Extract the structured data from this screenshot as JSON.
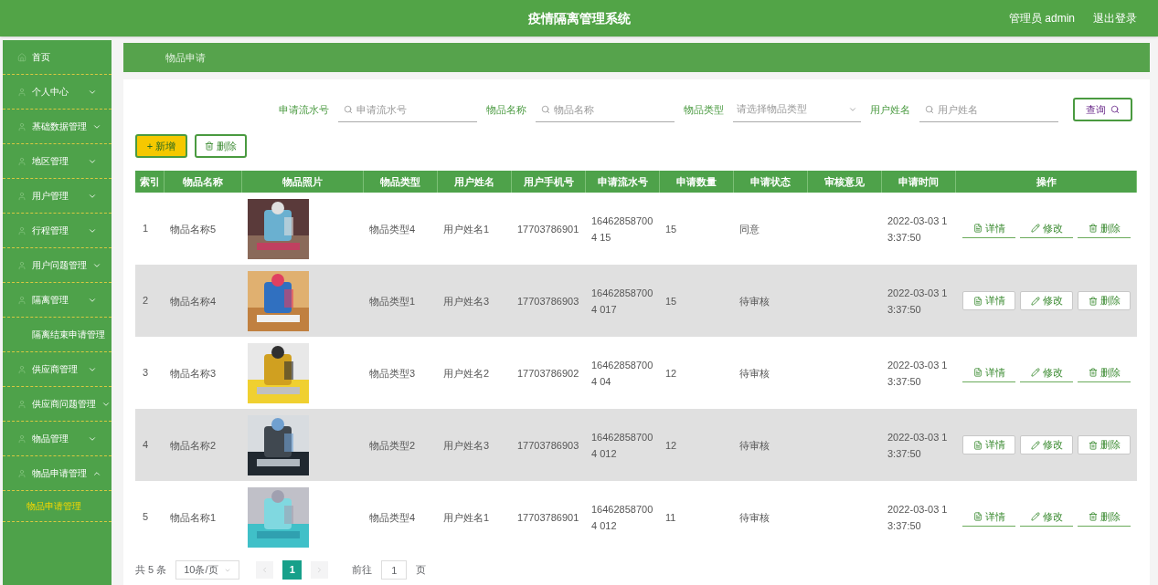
{
  "header": {
    "title": "疫情隔离管理系统",
    "user": "管理员 admin",
    "logout": "退出登录"
  },
  "sidebar": {
    "items": [
      {
        "label": "首页"
      },
      {
        "label": "个人中心",
        "expanded": false
      },
      {
        "label": "基础数据管理",
        "expanded": false
      },
      {
        "label": "地区管理",
        "expanded": false
      },
      {
        "label": "用户管理",
        "expanded": false
      },
      {
        "label": "行程管理",
        "expanded": false
      },
      {
        "label": "用户问题管理",
        "expanded": false
      },
      {
        "label": "隔离管理",
        "expanded": false
      },
      {
        "label": "隔离结束申请管理"
      },
      {
        "label": "供应商管理",
        "expanded": false
      },
      {
        "label": "供应商问题管理",
        "expanded": false
      },
      {
        "label": "物品管理",
        "expanded": false
      },
      {
        "label": "物品申请管理",
        "expanded": true,
        "children": [
          {
            "label": "物品申请管理",
            "selected": true
          }
        ]
      }
    ]
  },
  "breadcrumb": "物品申请",
  "search": {
    "fields": [
      {
        "kind": "input",
        "label": "申请流水号",
        "placeholder": "申请流水号"
      },
      {
        "kind": "input",
        "label": "物品名称",
        "placeholder": "物品名称"
      },
      {
        "kind": "select",
        "label": "物品类型",
        "placeholder": "请选择物品类型"
      },
      {
        "kind": "input",
        "label": "用户姓名",
        "placeholder": "用户姓名"
      }
    ],
    "button": "查询"
  },
  "toolbar": {
    "add": "+ 新增",
    "delete": "删除"
  },
  "table": {
    "columns": [
      "索引",
      "物品名称",
      "物品照片",
      "物品类型",
      "用户姓名",
      "用户手机号",
      "申请流水号",
      "申请数量",
      "申请状态",
      "审核意见",
      "申请时间",
      "操作"
    ],
    "rows": [
      {
        "index": "1",
        "name": "物品名称5",
        "type": "物品类型4",
        "user": "用户姓名1",
        "phone": "17703786901",
        "serial": "164628587004 15",
        "qty": "15",
        "status": "同意",
        "time": "2022-03-03 1 3:37:50",
        "photo": {
          "kind": "picture"
        },
        "actions": [
          "详情",
          "修改",
          "删除"
        ]
      },
      {
        "index": "2",
        "name": "物品名称4",
        "type": "物品类型1",
        "user": "用户姓名3",
        "phone": "17703786903",
        "serial": "164628587004 017",
        "qty": "15",
        "status": "待审核",
        "time": "2022-03-03 1 3:37:50",
        "photo": {
          "kind": "picture"
        },
        "actions": [
          "详情",
          "修改",
          "删除"
        ]
      },
      {
        "index": "3",
        "name": "物品名称3",
        "type": "物品类型3",
        "user": "用户姓名2",
        "phone": "17703786902",
        "serial": "164628587004 04",
        "qty": "12",
        "status": "待审核",
        "time": "2022-03-03 1 3:37:50",
        "photo": {
          "kind": "picture"
        },
        "actions": [
          "详情",
          "修改",
          "删除"
        ]
      },
      {
        "index": "4",
        "name": "物品名称2",
        "type": "物品类型2",
        "user": "用户姓名3",
        "phone": "17703786903",
        "serial": "164628587004 012",
        "qty": "12",
        "status": "待审核",
        "time": "2022-03-03 1 3:37:50",
        "photo": {
          "kind": "picture"
        },
        "actions": [
          "详情",
          "修改",
          "删除"
        ]
      },
      {
        "index": "5",
        "name": "物品名称1",
        "type": "物品类型4",
        "user": "用户姓名1",
        "phone": "17703786901",
        "serial": "164628587004 012",
        "qty": "11",
        "status": "待审核",
        "time": "2022-03-03 1 3:37:50",
        "photo": {
          "kind": "picture"
        },
        "actions": [
          "详情",
          "修改",
          "删除"
        ]
      }
    ]
  },
  "pagination": {
    "total": "共 5 条",
    "page_size": "10条/页",
    "pages": [
      {
        "label": "1",
        "selected": true
      }
    ],
    "goto": "前往",
    "goto_value": "1",
    "page_unit": "页"
  }
}
